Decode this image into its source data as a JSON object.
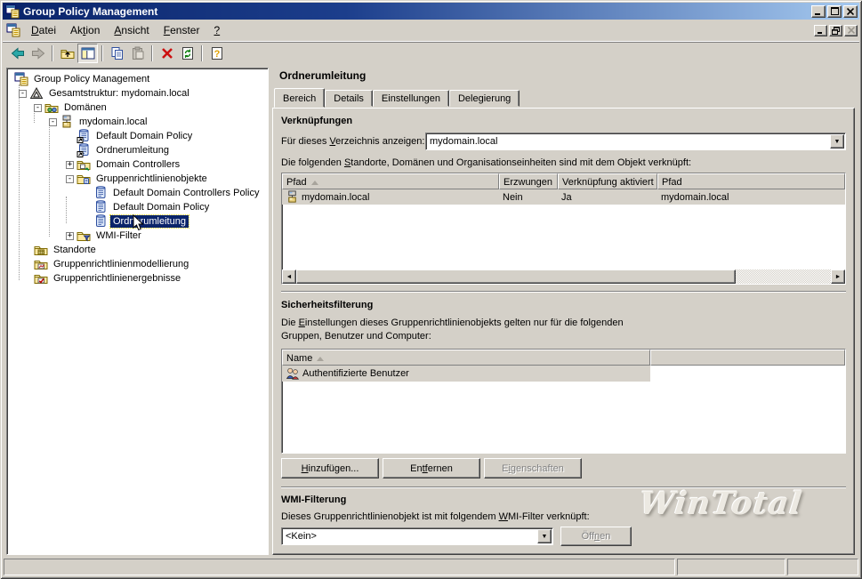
{
  "colors": {
    "titlebar_start": "#0A246A",
    "titlebar_end": "#A6CAF0",
    "face": "#D4D0C8",
    "selection": "#0A246A",
    "window_bg": "#FFFFFF"
  },
  "titlebar": {
    "title": "Group Policy Management"
  },
  "menubar": {
    "items": [
      {
        "pre": "",
        "accel": "D",
        "post": "atei"
      },
      {
        "pre": "Ak",
        "accel": "t",
        "post": "ion"
      },
      {
        "pre": "",
        "accel": "A",
        "post": "nsicht"
      },
      {
        "pre": "",
        "accel": "F",
        "post": "enster"
      },
      {
        "pre": "",
        "accel": "?",
        "post": ""
      }
    ]
  },
  "toolbar": {
    "buttons": [
      {
        "name": "back"
      },
      {
        "name": "forward"
      },
      {
        "name": "up-one-level"
      },
      {
        "name": "show-console-tree"
      },
      {
        "name": "copy"
      },
      {
        "name": "paste"
      },
      {
        "name": "delete"
      },
      {
        "name": "refresh"
      },
      {
        "name": "help"
      }
    ]
  },
  "tree": {
    "items": [
      {
        "label": "Group Policy Management",
        "expander": ""
      },
      {
        "label": "Gesamtstruktur: mydomain.local",
        "expander": "-"
      },
      {
        "label": "Domänen",
        "expander": "-"
      },
      {
        "label": "mydomain.local",
        "expander": "-"
      },
      {
        "label": "Default Domain Policy",
        "expander": ""
      },
      {
        "label": "Ordnerumleitung",
        "expander": ""
      },
      {
        "label": "Domain Controllers",
        "expander": "+"
      },
      {
        "label": "Gruppenrichtlinienobjekte",
        "expander": "-"
      },
      {
        "label": "Default Domain Controllers Policy",
        "expander": ""
      },
      {
        "label": "Default Domain Policy",
        "expander": ""
      },
      {
        "label": "Ordnerumleitung",
        "expander": ""
      },
      {
        "label": "WMI-Filter",
        "expander": "+"
      },
      {
        "label": "Standorte",
        "expander": ""
      },
      {
        "label": "Gruppenrichtlinienmodellierung",
        "expander": ""
      },
      {
        "label": "Gruppenrichtlinienergebnisse",
        "expander": ""
      }
    ]
  },
  "panel": {
    "title": "Ordnerumleitung",
    "tabs": [
      {
        "label": "Bereich"
      },
      {
        "label": "Details"
      },
      {
        "label": "Einstellungen"
      },
      {
        "label": "Delegierung"
      }
    ]
  },
  "links": {
    "heading": "Verknüpfungen",
    "display_label": {
      "pre": "Für dieses ",
      "accel": "V",
      "post": "erzeichnis anzeigen:"
    },
    "display_value": "mydomain.local",
    "description": {
      "pre": "Die folgenden ",
      "accel": "S",
      "post": "tandorte, Domänen und Organisationseinheiten sind mit dem Objekt verknüpft:"
    },
    "columns": [
      {
        "label": "Pfad"
      },
      {
        "label": "Erzwungen"
      },
      {
        "label": "Verknüpfung aktiviert"
      },
      {
        "label": "Pfad"
      }
    ],
    "rows": [
      {
        "path": "mydomain.local",
        "enforced": "Nein",
        "link_enabled": "Ja",
        "path2": "mydomain.local"
      }
    ]
  },
  "security": {
    "heading": "Sicherheitsfilterung",
    "description_line1": {
      "pre": "Die ",
      "accel": "E",
      "post": "instellungen dieses Gruppenrichtlinienobjekts gelten nur für die folgenden"
    },
    "description_line2": "Gruppen, Benutzer und Computer:",
    "columns": [
      {
        "label": "Name"
      }
    ],
    "rows": [
      {
        "name": "Authentifizierte Benutzer"
      }
    ],
    "buttons": {
      "add": {
        "pre": "",
        "accel": "H",
        "post": "inzufügen..."
      },
      "remove": {
        "pre": "En",
        "accel": "tf",
        "post": "ernen"
      },
      "properties": {
        "pre": "E",
        "accel": "i",
        "post": "genschaften"
      }
    }
  },
  "wmi": {
    "heading": "WMI-Filterung",
    "description": {
      "pre": "Dieses Gruppenrichtlinienobjekt ist mit folgendem ",
      "accel": "W",
      "post": "MI-Filter verknüpft:"
    },
    "filter_value": "<Kein>",
    "open_button": {
      "pre": "Öff",
      "accel": "n",
      "post": "en"
    }
  },
  "watermark": "WinTotal",
  "statusbar": {
    "cells": [
      {
        "text": ""
      },
      {
        "text": ""
      },
      {
        "text": ""
      }
    ]
  }
}
